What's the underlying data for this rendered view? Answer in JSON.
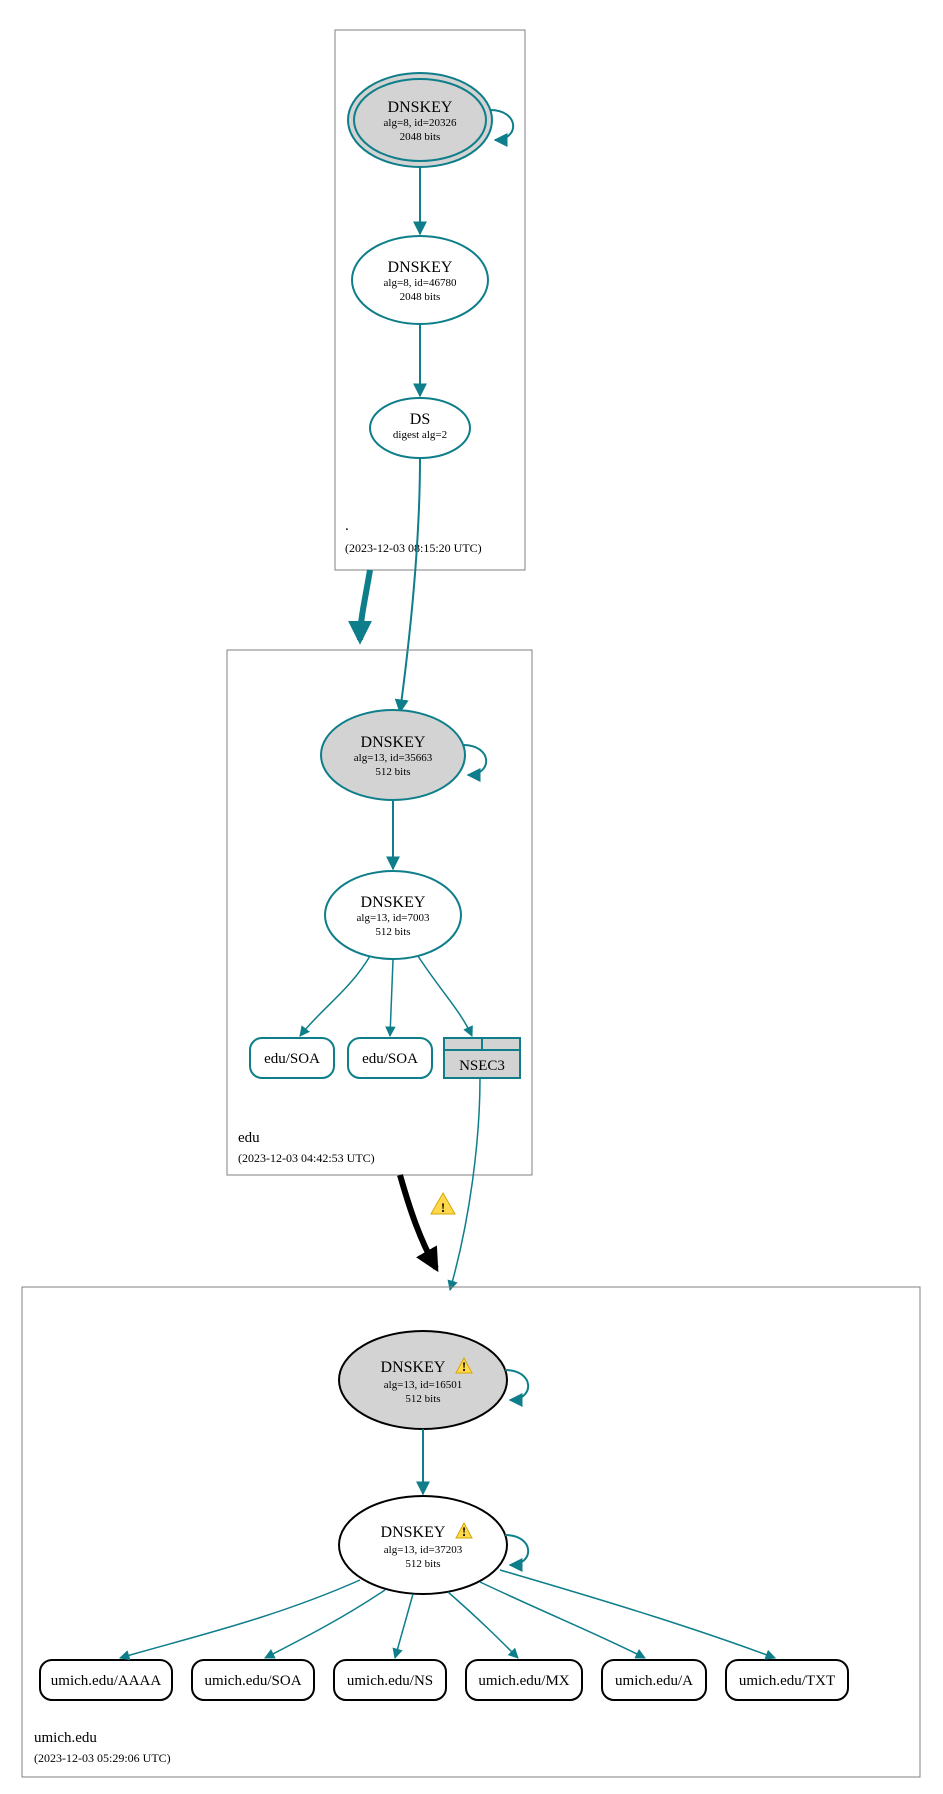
{
  "zones": {
    "root": {
      "label": ".",
      "timestamp": "(2023-12-03 08:15:20 UTC)"
    },
    "edu": {
      "label": "edu",
      "timestamp": "(2023-12-03 04:42:53 UTC)"
    },
    "umich": {
      "label": "umich.edu",
      "timestamp": "(2023-12-03 05:29:06 UTC)"
    }
  },
  "nodes": {
    "root_ksk": {
      "title": "DNSKEY",
      "line1": "alg=8, id=20326",
      "line2": "2048 bits"
    },
    "root_zsk": {
      "title": "DNSKEY",
      "line1": "alg=8, id=46780",
      "line2": "2048 bits"
    },
    "root_ds": {
      "title": "DS",
      "line1": "digest alg=2"
    },
    "edu_ksk": {
      "title": "DNSKEY",
      "line1": "alg=13, id=35663",
      "line2": "512 bits"
    },
    "edu_zsk": {
      "title": "DNSKEY",
      "line1": "alg=13, id=7003",
      "line2": "512 bits"
    },
    "edu_soa1": {
      "label": "edu/SOA"
    },
    "edu_soa2": {
      "label": "edu/SOA"
    },
    "nsec3": {
      "label": "NSEC3"
    },
    "umich_ksk": {
      "title": "DNSKEY",
      "line1": "alg=13, id=16501",
      "line2": "512 bits"
    },
    "umich_zsk": {
      "title": "DNSKEY",
      "line1": "alg=13, id=37203",
      "line2": "512 bits"
    },
    "rr_aaaa": {
      "label": "umich.edu/AAAA"
    },
    "rr_soa": {
      "label": "umich.edu/SOA"
    },
    "rr_ns": {
      "label": "umich.edu/NS"
    },
    "rr_mx": {
      "label": "umich.edu/MX"
    },
    "rr_a": {
      "label": "umich.edu/A"
    },
    "rr_txt": {
      "label": "umich.edu/TXT"
    }
  }
}
